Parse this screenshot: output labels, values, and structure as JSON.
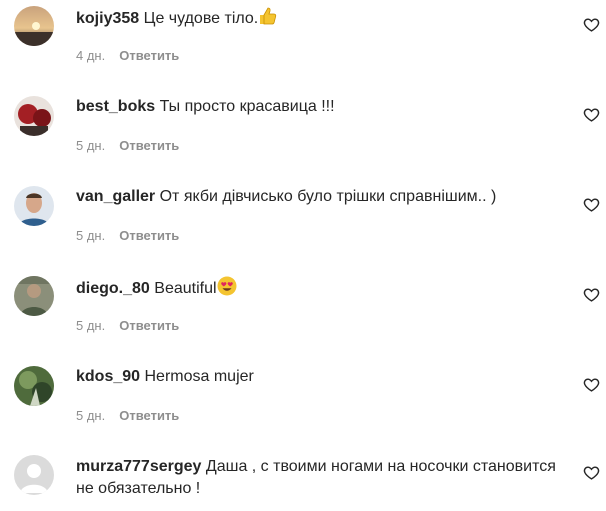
{
  "comments": [
    {
      "username": "kojiy358",
      "text": "Це чудове тіло.",
      "emoji": "thumbs-up-emoji",
      "age": "4 дн.",
      "reply": "Ответить"
    },
    {
      "username": "best_boks",
      "text": "Ты просто красавица !!!",
      "age": "5 дн.",
      "reply": "Ответить"
    },
    {
      "username": "van_galler",
      "text": "От якби дівчисько було трішки справнішим.. )",
      "age": "5 дн.",
      "reply": "Ответить"
    },
    {
      "username": "diego._80",
      "text": "Beautiful",
      "emoji": "heart-eyes-emoji",
      "age": "5 дн.",
      "reply": "Ответить"
    },
    {
      "username": "kdos_90",
      "text": "Hermosa mujer",
      "age": "5 дн.",
      "reply": "Ответить"
    },
    {
      "username": "murza777sergey",
      "text": "Даша , с твоими ногами на носочки становится не обязательно !",
      "age": "",
      "reply": ""
    }
  ],
  "icons": {
    "like": "heart-outline-icon"
  },
  "colors": {
    "text": "#262626",
    "secondary": "#8e8e8e",
    "emoji_yellow": "#f4c430",
    "emoji_heart": "#e0245e"
  }
}
